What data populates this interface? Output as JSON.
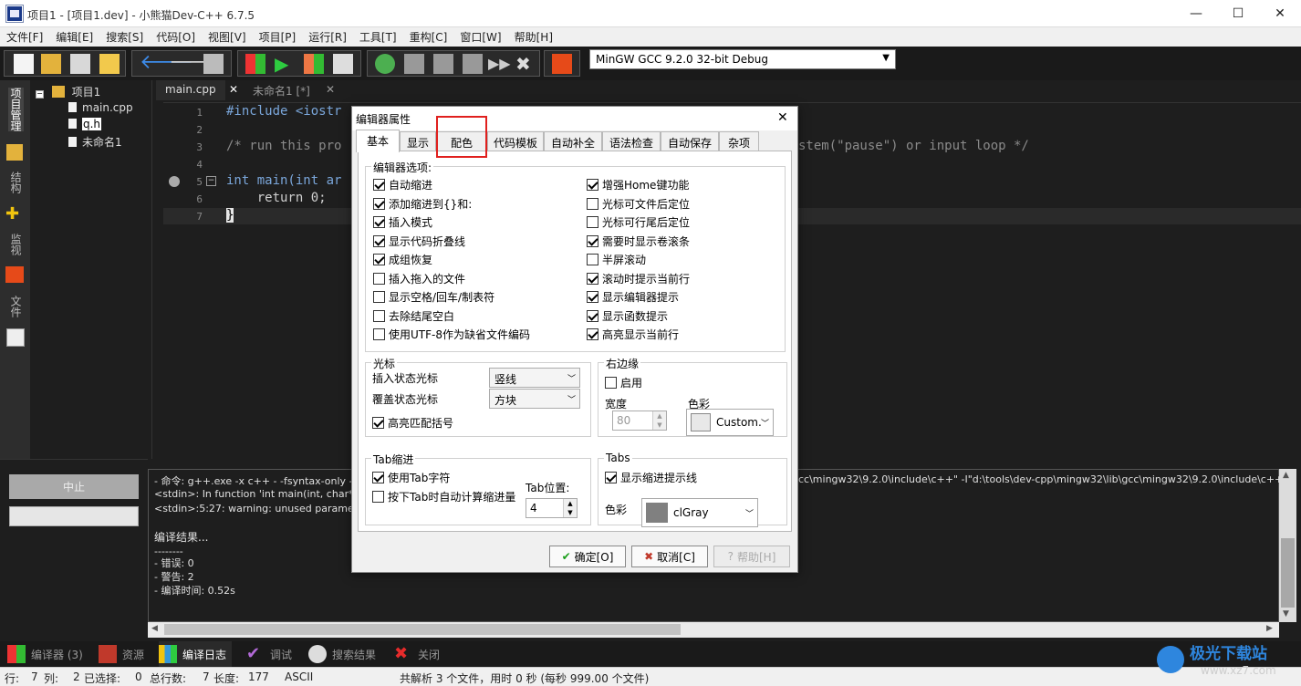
{
  "window": {
    "title": "项目1 - [项目1.dev] - 小熊猫Dev-C++ 6.7.5"
  },
  "menu": [
    "文件[F]",
    "编辑[E]",
    "搜索[S]",
    "代码[O]",
    "视图[V]",
    "项目[P]",
    "运行[R]",
    "工具[T]",
    "重构[C]",
    "窗口[W]",
    "帮助[H]"
  ],
  "toolbar": {
    "compiler": "MinGW GCC 9.2.0 32-bit Debug"
  },
  "side_tabs": [
    "项目管理",
    "结构",
    "监视",
    "文件"
  ],
  "project_tree": {
    "root": "项目1",
    "files": [
      "main.cpp",
      "q.h",
      "未命名1"
    ]
  },
  "editor": {
    "tabs": [
      "main.cpp",
      "未命名1 [*]"
    ],
    "lines": [
      {
        "n": "1",
        "text": "#include <iostr"
      },
      {
        "n": "2",
        "text": ""
      },
      {
        "n": "3",
        "text": "/* run this pro"
      },
      {
        "n": "4",
        "text": ""
      },
      {
        "n": "5",
        "text": "int main(int ar"
      },
      {
        "n": "6",
        "text": "    return 0;"
      },
      {
        "n": "7",
        "text": "}"
      }
    ],
    "comment_tail": "stem(\"pause\") or input loop */"
  },
  "compile": {
    "stop_label": "中止",
    "log": [
      "- 命令: g++.exe -x c++ - -fsyntax-only -W",
      "<stdin>: In function 'int main(int, char**)",
      "<stdin>:5:27: warning: unused parameter",
      "",
      "编译结果...",
      "--------",
      "- 错误: 0",
      "- 警告: 2",
      "- 编译时间: 0.52s"
    ],
    "log_right": "cc\\mingw32\\9.2.0\\include\\c++\" -I\"d:\\tools\\dev-cpp\\mingw32\\lib\\gcc\\mingw32\\9.2.0\\include\\c++-"
  },
  "bottom_tabs": [
    "编译器 (3)",
    "资源",
    "编译日志",
    "调试",
    "搜索结果",
    "关闭"
  ],
  "status": {
    "row_label": "行:",
    "row": "7",
    "col_label": "列:",
    "col": "2",
    "sel_label": "已选择:",
    "sel": "0",
    "total_label": "总行数:",
    "total": "7",
    "len_label": "长度:",
    "len": "177",
    "enc": "ASCII",
    "parse": "共解析 3 个文件，用时 0 秒 (每秒 999.00 个文件)"
  },
  "dialog": {
    "title": "编辑器属性",
    "tabs": [
      "基本",
      "显示",
      "配色",
      "代码模板",
      "自动补全",
      "语法检查",
      "自动保存",
      "杂项"
    ],
    "options_group": "编辑器选项:",
    "left_options": [
      {
        "label": "自动缩进",
        "checked": true
      },
      {
        "label": "添加缩进到{}和:",
        "checked": true
      },
      {
        "label": "插入模式",
        "checked": true
      },
      {
        "label": "显示代码折叠线",
        "checked": true
      },
      {
        "label": "成组恢复",
        "checked": true
      },
      {
        "label": "插入拖入的文件",
        "checked": false
      },
      {
        "label": "显示空格/回车/制表符",
        "checked": false
      },
      {
        "label": "去除结尾空白",
        "checked": false
      },
      {
        "label": "使用UTF-8作为缺省文件编码",
        "checked": false
      }
    ],
    "right_options": [
      {
        "label": "增强Home键功能",
        "checked": true
      },
      {
        "label": "光标可文件后定位",
        "checked": false
      },
      {
        "label": "光标可行尾后定位",
        "checked": false
      },
      {
        "label": "需要时显示卷滚条",
        "checked": true
      },
      {
        "label": "半屏滚动",
        "checked": false
      },
      {
        "label": "滚动时提示当前行",
        "checked": true
      },
      {
        "label": "显示编辑器提示",
        "checked": true
      },
      {
        "label": "显示函数提示",
        "checked": true
      },
      {
        "label": "高亮显示当前行",
        "checked": true
      }
    ],
    "caret": {
      "group": "光标",
      "insert_label": "插入状态光标",
      "insert_value": "竖线",
      "overwrite_label": "覆盖状态光标",
      "overwrite_value": "方块",
      "match_label": "高亮匹配括号"
    },
    "margin": {
      "group": "右边缘",
      "enable_label": "启用",
      "width_label": "宽度",
      "width_value": "80",
      "color_label": "色彩",
      "color_value": "Custom."
    },
    "tab_indent": {
      "group": "Tab缩进",
      "use_tab": "使用Tab字符",
      "auto_calc": "按下Tab时自动计算缩进量",
      "pos_label": "Tab位置:",
      "pos_value": "4"
    },
    "tabs_group": {
      "group": "Tabs",
      "show_guides": "显示缩进提示线",
      "color_label": "色彩",
      "color_value": "clGray"
    },
    "buttons": {
      "ok": "确定[O]",
      "cancel": "取消[C]",
      "help": "帮助[H]"
    }
  },
  "watermark": {
    "brand": "极光下载站",
    "url": "www.xz7.com"
  }
}
